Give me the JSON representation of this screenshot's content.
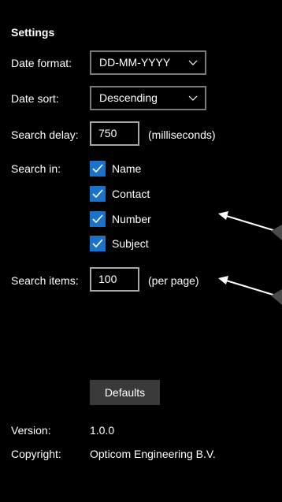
{
  "settings": {
    "title": "Settings",
    "date_format": {
      "label": "Date format:",
      "value": "DD-MM-YYYY",
      "icon": "chevron-down-icon"
    },
    "date_sort": {
      "label": "Date sort:",
      "value": "Descending",
      "icon": "chevron-down-icon"
    },
    "search_delay": {
      "label": "Search delay:",
      "value": "750",
      "unit": "(milliseconds)"
    },
    "search_in": {
      "label": "Search in:",
      "options": [
        {
          "label": "Name",
          "checked": true
        },
        {
          "label": "Contact",
          "checked": true
        },
        {
          "label": "Number",
          "checked": true
        },
        {
          "label": "Subject",
          "checked": true
        }
      ]
    },
    "search_items": {
      "label": "Search items:",
      "value": "100",
      "unit": "(per page)"
    },
    "defaults_button": "Defaults",
    "version": {
      "label": "Version:",
      "value": "1.0.0"
    },
    "copyright": {
      "label": "Copyright:",
      "value": "Opticom Engineering B.V."
    }
  },
  "colors": {
    "background": "#000000",
    "checkbox_fill": "#1a73c9",
    "button_fill": "#3a3a3a",
    "select_border": "#7a7a7a"
  }
}
